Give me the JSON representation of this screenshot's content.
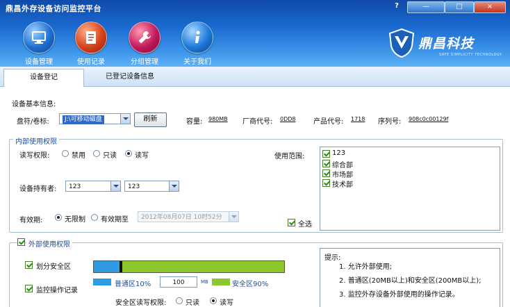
{
  "window": {
    "title": "鼎昌外存设备访问监控平台",
    "help_label": "?",
    "min_label": "—",
    "max_label": "□",
    "close_label": "×"
  },
  "nav": [
    {
      "label": "设备管理",
      "icon": "monitor-icon"
    },
    {
      "label": "使用记录",
      "icon": "notebook-icon"
    },
    {
      "label": "分组管理",
      "icon": "wrench-icon"
    },
    {
      "label": "关于我们",
      "icon": "info-icon"
    }
  ],
  "brand": {
    "name": "鼎昌科技",
    "tagline": "SAFE SIMPLICITY TECHNOLOGY"
  },
  "tabs": [
    {
      "label": "设备登记",
      "active": true
    },
    {
      "label": "已登记设备信息",
      "active": false
    }
  ],
  "basic": {
    "heading": "设备基本信息:",
    "drive_label": "盘符/卷标:",
    "drive_value": "J:\\可移动磁盘",
    "refresh_label": "刷新",
    "capacity_label": "容量:",
    "capacity_value": "980MB",
    "vendor_label": "厂商代号:",
    "vendor_value": "0DD8",
    "product_label": "产品代号:",
    "product_value": "1718",
    "serial_label": "序列号:",
    "serial_value": "908c0c00129f"
  },
  "internal": {
    "legend": "内部使用权限",
    "rw_label": "读写权限:",
    "rw_options": [
      "禁用",
      "只读",
      "读写"
    ],
    "rw_selected": 2,
    "owner_label": "设备持有者:",
    "owner_value1": "123",
    "owner_value2": "123",
    "validity_label": "有效期:",
    "validity_options": [
      "无限制",
      "有效期至"
    ],
    "validity_selected": 0,
    "validity_date": "2012年08月07日 10时52分",
    "scope_label": "使用范围:",
    "scope_items": [
      {
        "label": "123",
        "checked": true
      },
      {
        "label": "综合部",
        "checked": true
      },
      {
        "label": "市场部",
        "checked": true
      },
      {
        "label": "技术部",
        "checked": true
      }
    ],
    "select_all_label": "全选",
    "select_all_checked": true
  },
  "external": {
    "legend": "外部使用权限",
    "legend_checked": true,
    "partition_label": "划分安全区",
    "partition_checked": true,
    "normal_fraction": 0.1,
    "normal_legend": "普通区10%",
    "normal_mb_value": "100",
    "mb_unit": "MB",
    "secure_legend": "安全区90%",
    "monitor_label": "监控操作记录",
    "monitor_checked": true,
    "secure_rw_label": "安全区读写权限:",
    "secure_rw_options": [
      "只读",
      "读写"
    ],
    "secure_rw_selected": 1,
    "normal_color": "#2f9be0",
    "secure_color": "#8cc72d"
  },
  "tips": {
    "heading": "提示:",
    "items": [
      "1. 允许外部使用;",
      "2. 普通区(20MB以上)和安全区(200MB以上);",
      "3. 监控外存设备外部使用的操作记录。"
    ]
  }
}
